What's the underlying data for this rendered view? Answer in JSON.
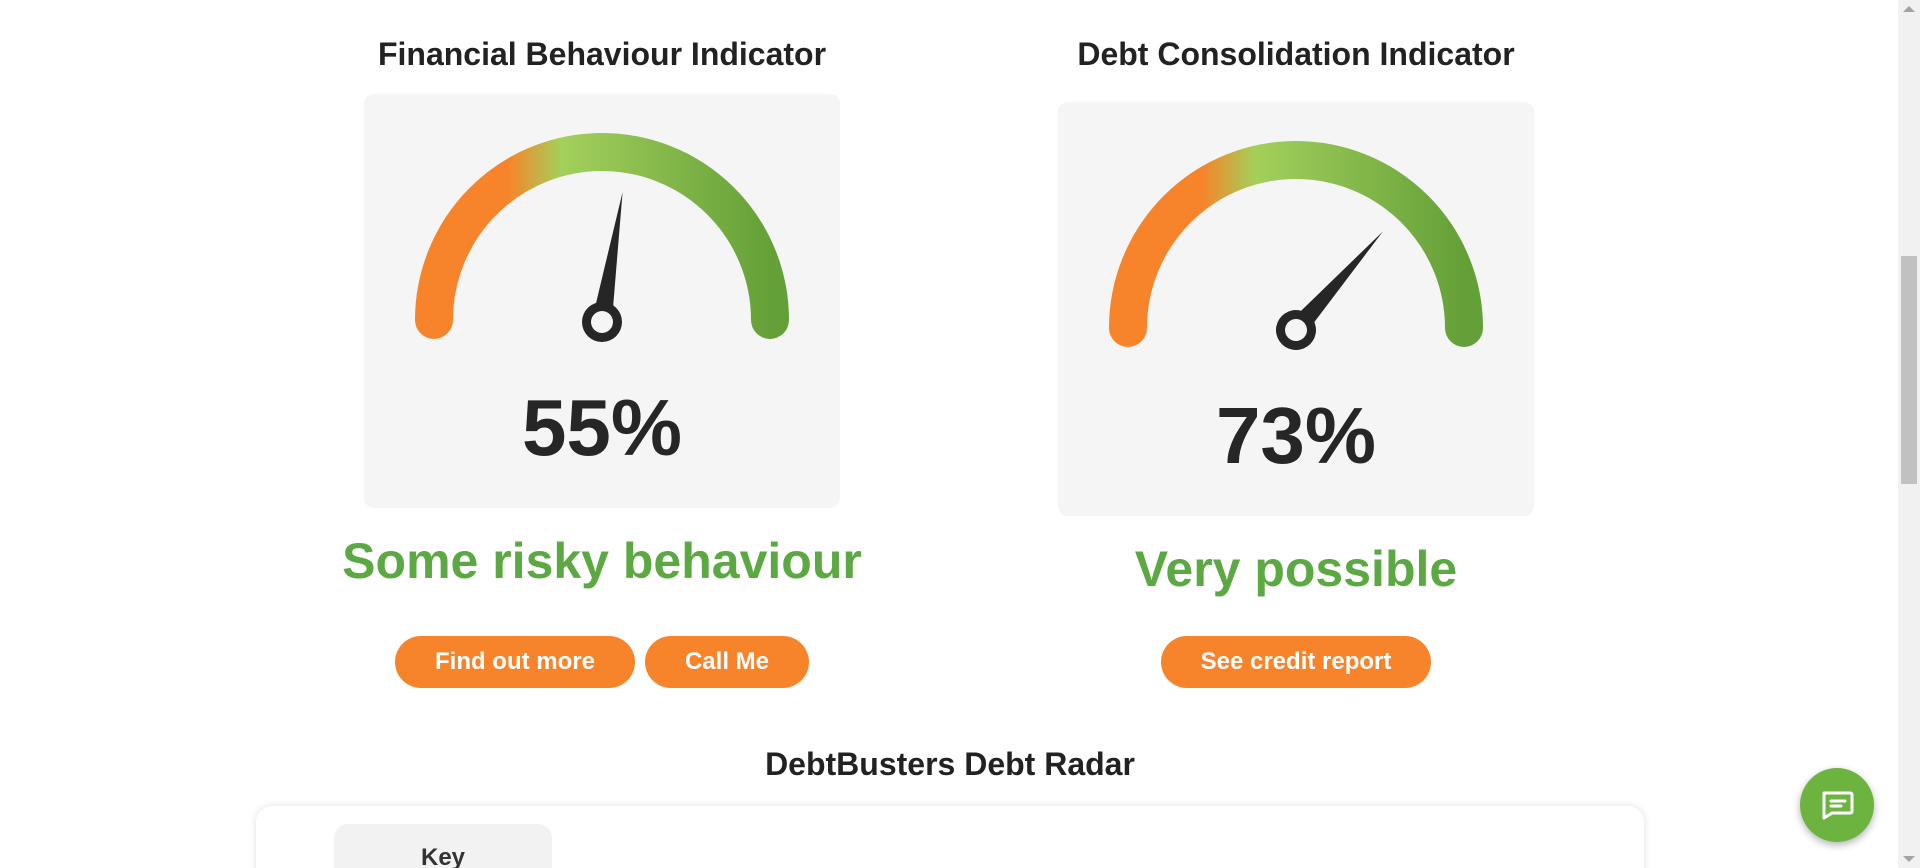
{
  "financial_indicator": {
    "title": "Financial Behaviour Indicator",
    "value_text": "55%",
    "value": 55,
    "status": "Some risky behaviour",
    "buttons": [
      "Find out more",
      "Call Me"
    ]
  },
  "debt_indicator": {
    "title": "Debt Consolidation Indicator",
    "value_text": "73%",
    "value": 73,
    "status": "Very possible",
    "buttons": [
      "See credit report"
    ]
  },
  "radar": {
    "title": "DebtBusters Debt Radar",
    "key_label": "Key"
  },
  "colors": {
    "orange": "#f7842a",
    "light_green": "#a3d05b",
    "dark_green": "#64a038",
    "status_green": "#5ca843",
    "needle": "#262626",
    "chat": "#6db33f"
  },
  "icons": {
    "chat": "chat-bubble-icon"
  }
}
